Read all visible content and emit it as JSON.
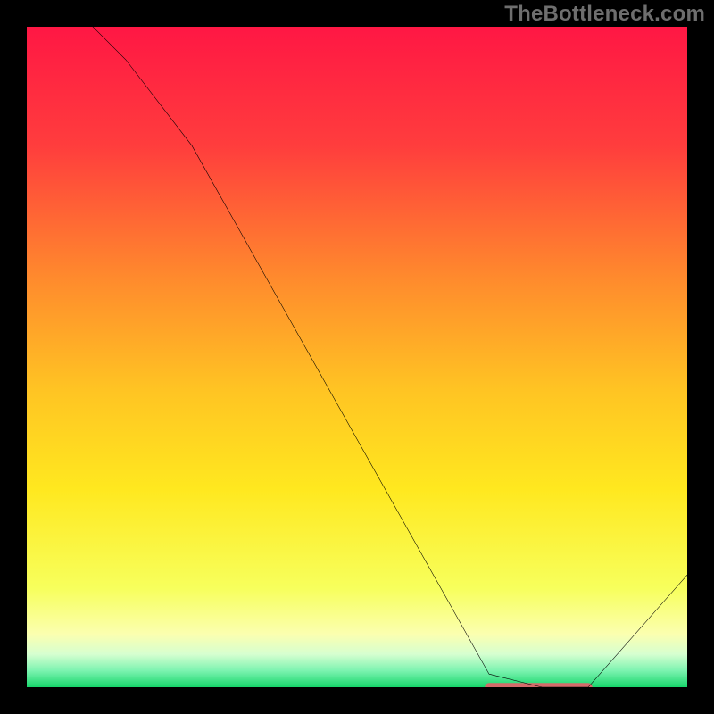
{
  "watermark": "TheBottleneck.com",
  "chart_data": {
    "type": "line",
    "title": "",
    "xlabel": "",
    "ylabel": "",
    "xlim": [
      0,
      100
    ],
    "ylim": [
      0,
      100
    ],
    "grid": false,
    "legend": false,
    "series": [
      {
        "name": "curve",
        "color": "#000000",
        "x": [
          0,
          15,
          25,
          70,
          78,
          85,
          100
        ],
        "values": [
          110,
          95,
          82,
          2,
          0,
          0,
          17
        ]
      }
    ],
    "background_gradient": {
      "stops": [
        {
          "pos": 0.0,
          "color": "#ff1744"
        },
        {
          "pos": 0.18,
          "color": "#ff3d3d"
        },
        {
          "pos": 0.38,
          "color": "#ff8a2d"
        },
        {
          "pos": 0.55,
          "color": "#ffc423"
        },
        {
          "pos": 0.7,
          "color": "#ffe81f"
        },
        {
          "pos": 0.85,
          "color": "#f7ff5c"
        },
        {
          "pos": 0.92,
          "color": "#fbffb0"
        },
        {
          "pos": 0.95,
          "color": "#d6ffd0"
        },
        {
          "pos": 0.975,
          "color": "#7cf3b0"
        },
        {
          "pos": 1.0,
          "color": "#17d66b"
        }
      ]
    },
    "marker_bar": {
      "x_start": 70,
      "x_end": 85,
      "y": 0,
      "color": "#d46a6a",
      "thickness": 1.3
    }
  }
}
